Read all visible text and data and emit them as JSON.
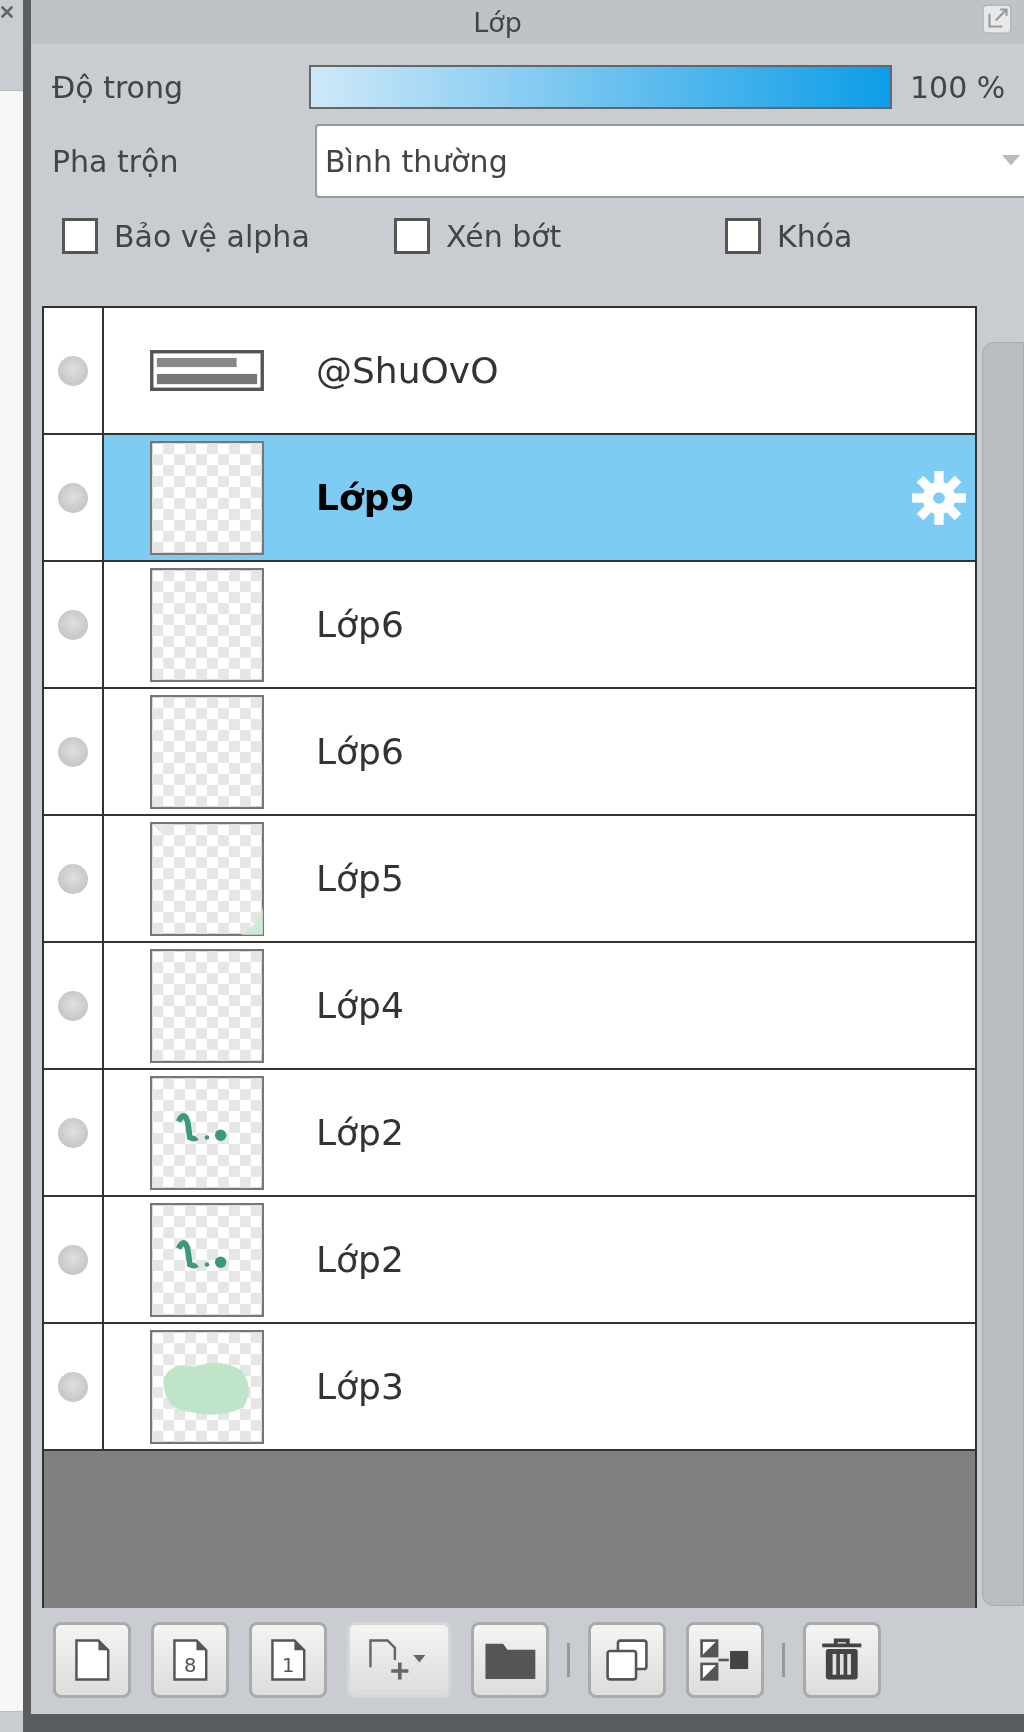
{
  "panel": {
    "title": "Lớp"
  },
  "opacity": {
    "label": "Độ trong",
    "level": 1,
    "reading": "100 %"
  },
  "blend": {
    "label": "Pha trộn",
    "value": "Bình thường"
  },
  "options": [
    {
      "label": "Bảo vệ alpha",
      "checked": false
    },
    {
      "label": "Xén bớt",
      "checked": false
    },
    {
      "label": "Khóa",
      "checked": false
    }
  ],
  "layers": [
    {
      "name": "@ShuOvO",
      "kind": "text",
      "selected": false
    },
    {
      "name": "Lớp9",
      "kind": "blank",
      "selected": true
    },
    {
      "name": "Lớp6",
      "kind": "blank",
      "selected": false
    },
    {
      "name": "Lớp6",
      "kind": "blank",
      "selected": false
    },
    {
      "name": "Lớp5",
      "kind": "corner",
      "selected": false
    },
    {
      "name": "Lớp4",
      "kind": "blank",
      "selected": false
    },
    {
      "name": "Lớp2",
      "kind": "sketch",
      "selected": false
    },
    {
      "name": "Lớp2",
      "kind": "sketch",
      "selected": false
    },
    {
      "name": "Lớp3",
      "kind": "fill",
      "selected": false
    }
  ],
  "toolbar": [
    {
      "kind": "page"
    },
    {
      "kind": "page",
      "label": "8"
    },
    {
      "kind": "page",
      "label": "1"
    },
    {
      "kind": "add"
    },
    {
      "kind": "folder"
    },
    {
      "kind": "separator"
    },
    {
      "kind": "copy"
    },
    {
      "kind": "merge"
    },
    {
      "kind": "separator"
    },
    {
      "kind": "trash"
    }
  ]
}
